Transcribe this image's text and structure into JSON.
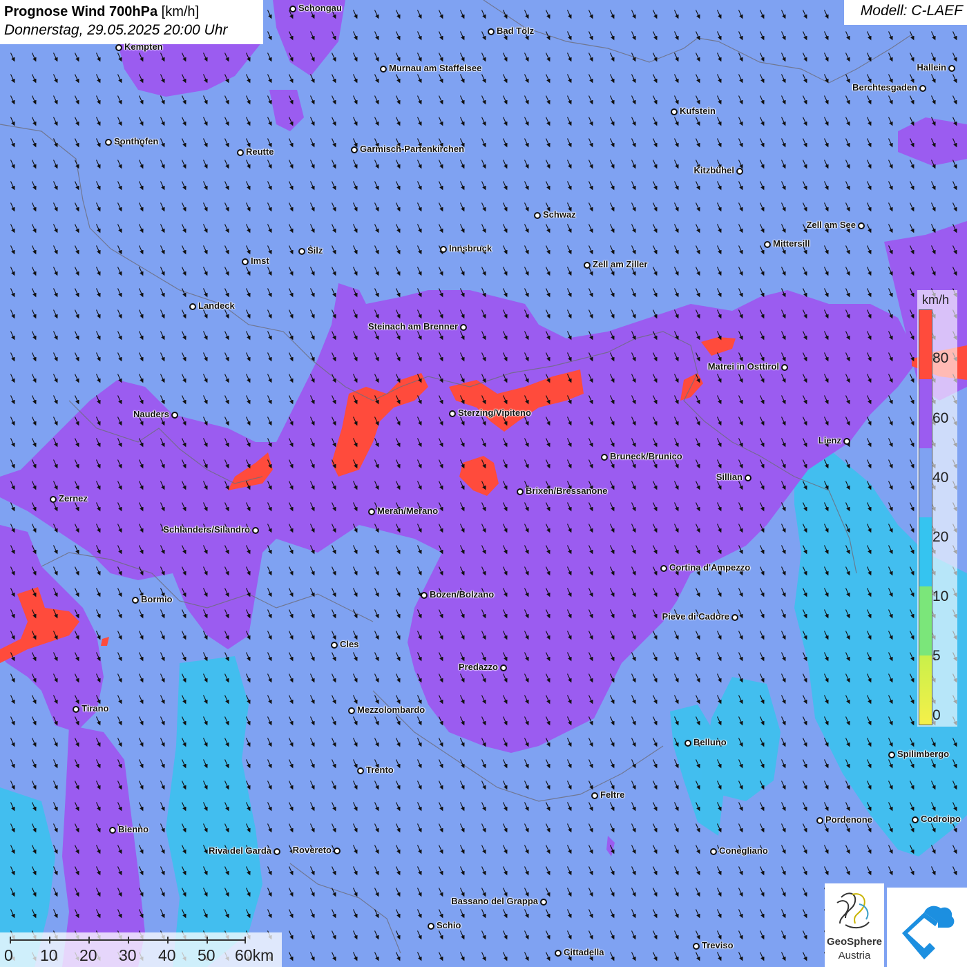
{
  "title": {
    "main": "Prognose Wind 700hPa",
    "unit": " [km/h]",
    "datetime": "Donnerstag, 29.05.2025 20:00 Uhr"
  },
  "model": "Modell: C-LAEF",
  "legend": {
    "unit": "km/h",
    "labels": [
      "80",
      "60",
      "40",
      "20",
      "10",
      "5",
      "0"
    ],
    "colors": [
      "#ff4b3c",
      "#9b5cf0",
      "#7fa2f2",
      "#35c4f0",
      "#7be67a",
      "#c9f04a",
      "#f5f04a"
    ]
  },
  "scale": {
    "labels": [
      "0",
      "10",
      "20",
      "30",
      "40",
      "50",
      "60km"
    ]
  },
  "logos": {
    "geosphere_line1": "GeoSphere",
    "geosphere_line2": "Austria"
  },
  "cities": [
    {
      "name": "Schongau"
    },
    {
      "name": "Bad Tölz"
    },
    {
      "name": "Kempten"
    },
    {
      "name": "Murnau am Staffelsee"
    },
    {
      "name": "Hallein"
    },
    {
      "name": "Berchtesgaden"
    },
    {
      "name": "Kufstein"
    },
    {
      "name": "Sonthofen"
    },
    {
      "name": "Reutte"
    },
    {
      "name": "Garmisch-Partenkirchen"
    },
    {
      "name": "Kitzbühel"
    },
    {
      "name": "Schwaz"
    },
    {
      "name": "Zell am See"
    },
    {
      "name": "Innsbruck"
    },
    {
      "name": "Mittersill"
    },
    {
      "name": "Silz"
    },
    {
      "name": "Imst"
    },
    {
      "name": "Zell am Ziller"
    },
    {
      "name": "Landeck"
    },
    {
      "name": "Steinach am Brenner"
    },
    {
      "name": "Matrei in Osttirol"
    },
    {
      "name": "Nauders"
    },
    {
      "name": "Sterzing/Vipiteno"
    },
    {
      "name": "Lienz"
    },
    {
      "name": "Bruneck/Brunico"
    },
    {
      "name": "Sillian"
    },
    {
      "name": "Brixen/Bressanone"
    },
    {
      "name": "Zernez"
    },
    {
      "name": "Meran/Merano"
    },
    {
      "name": "Schlanders/Silandro"
    },
    {
      "name": "Cortina d'Ampezzo"
    },
    {
      "name": "Bozen/Bolzano"
    },
    {
      "name": "Bormio"
    },
    {
      "name": "Pieve di Cadore"
    },
    {
      "name": "Cles"
    },
    {
      "name": "Predazzo"
    },
    {
      "name": "Tirano"
    },
    {
      "name": "Mezzolombardo"
    },
    {
      "name": "Belluno"
    },
    {
      "name": "Spilimbergo"
    },
    {
      "name": "Trento"
    },
    {
      "name": "Feltre"
    },
    {
      "name": "Pordenone"
    },
    {
      "name": "Codroipo"
    },
    {
      "name": "Bienno"
    },
    {
      "name": "Riva del Garda"
    },
    {
      "name": "Rovereto"
    },
    {
      "name": "Conegliano"
    },
    {
      "name": "Bassano del Grappa"
    },
    {
      "name": "Schio"
    },
    {
      "name": "Treviso"
    },
    {
      "name": "Cittadella"
    }
  ]
}
